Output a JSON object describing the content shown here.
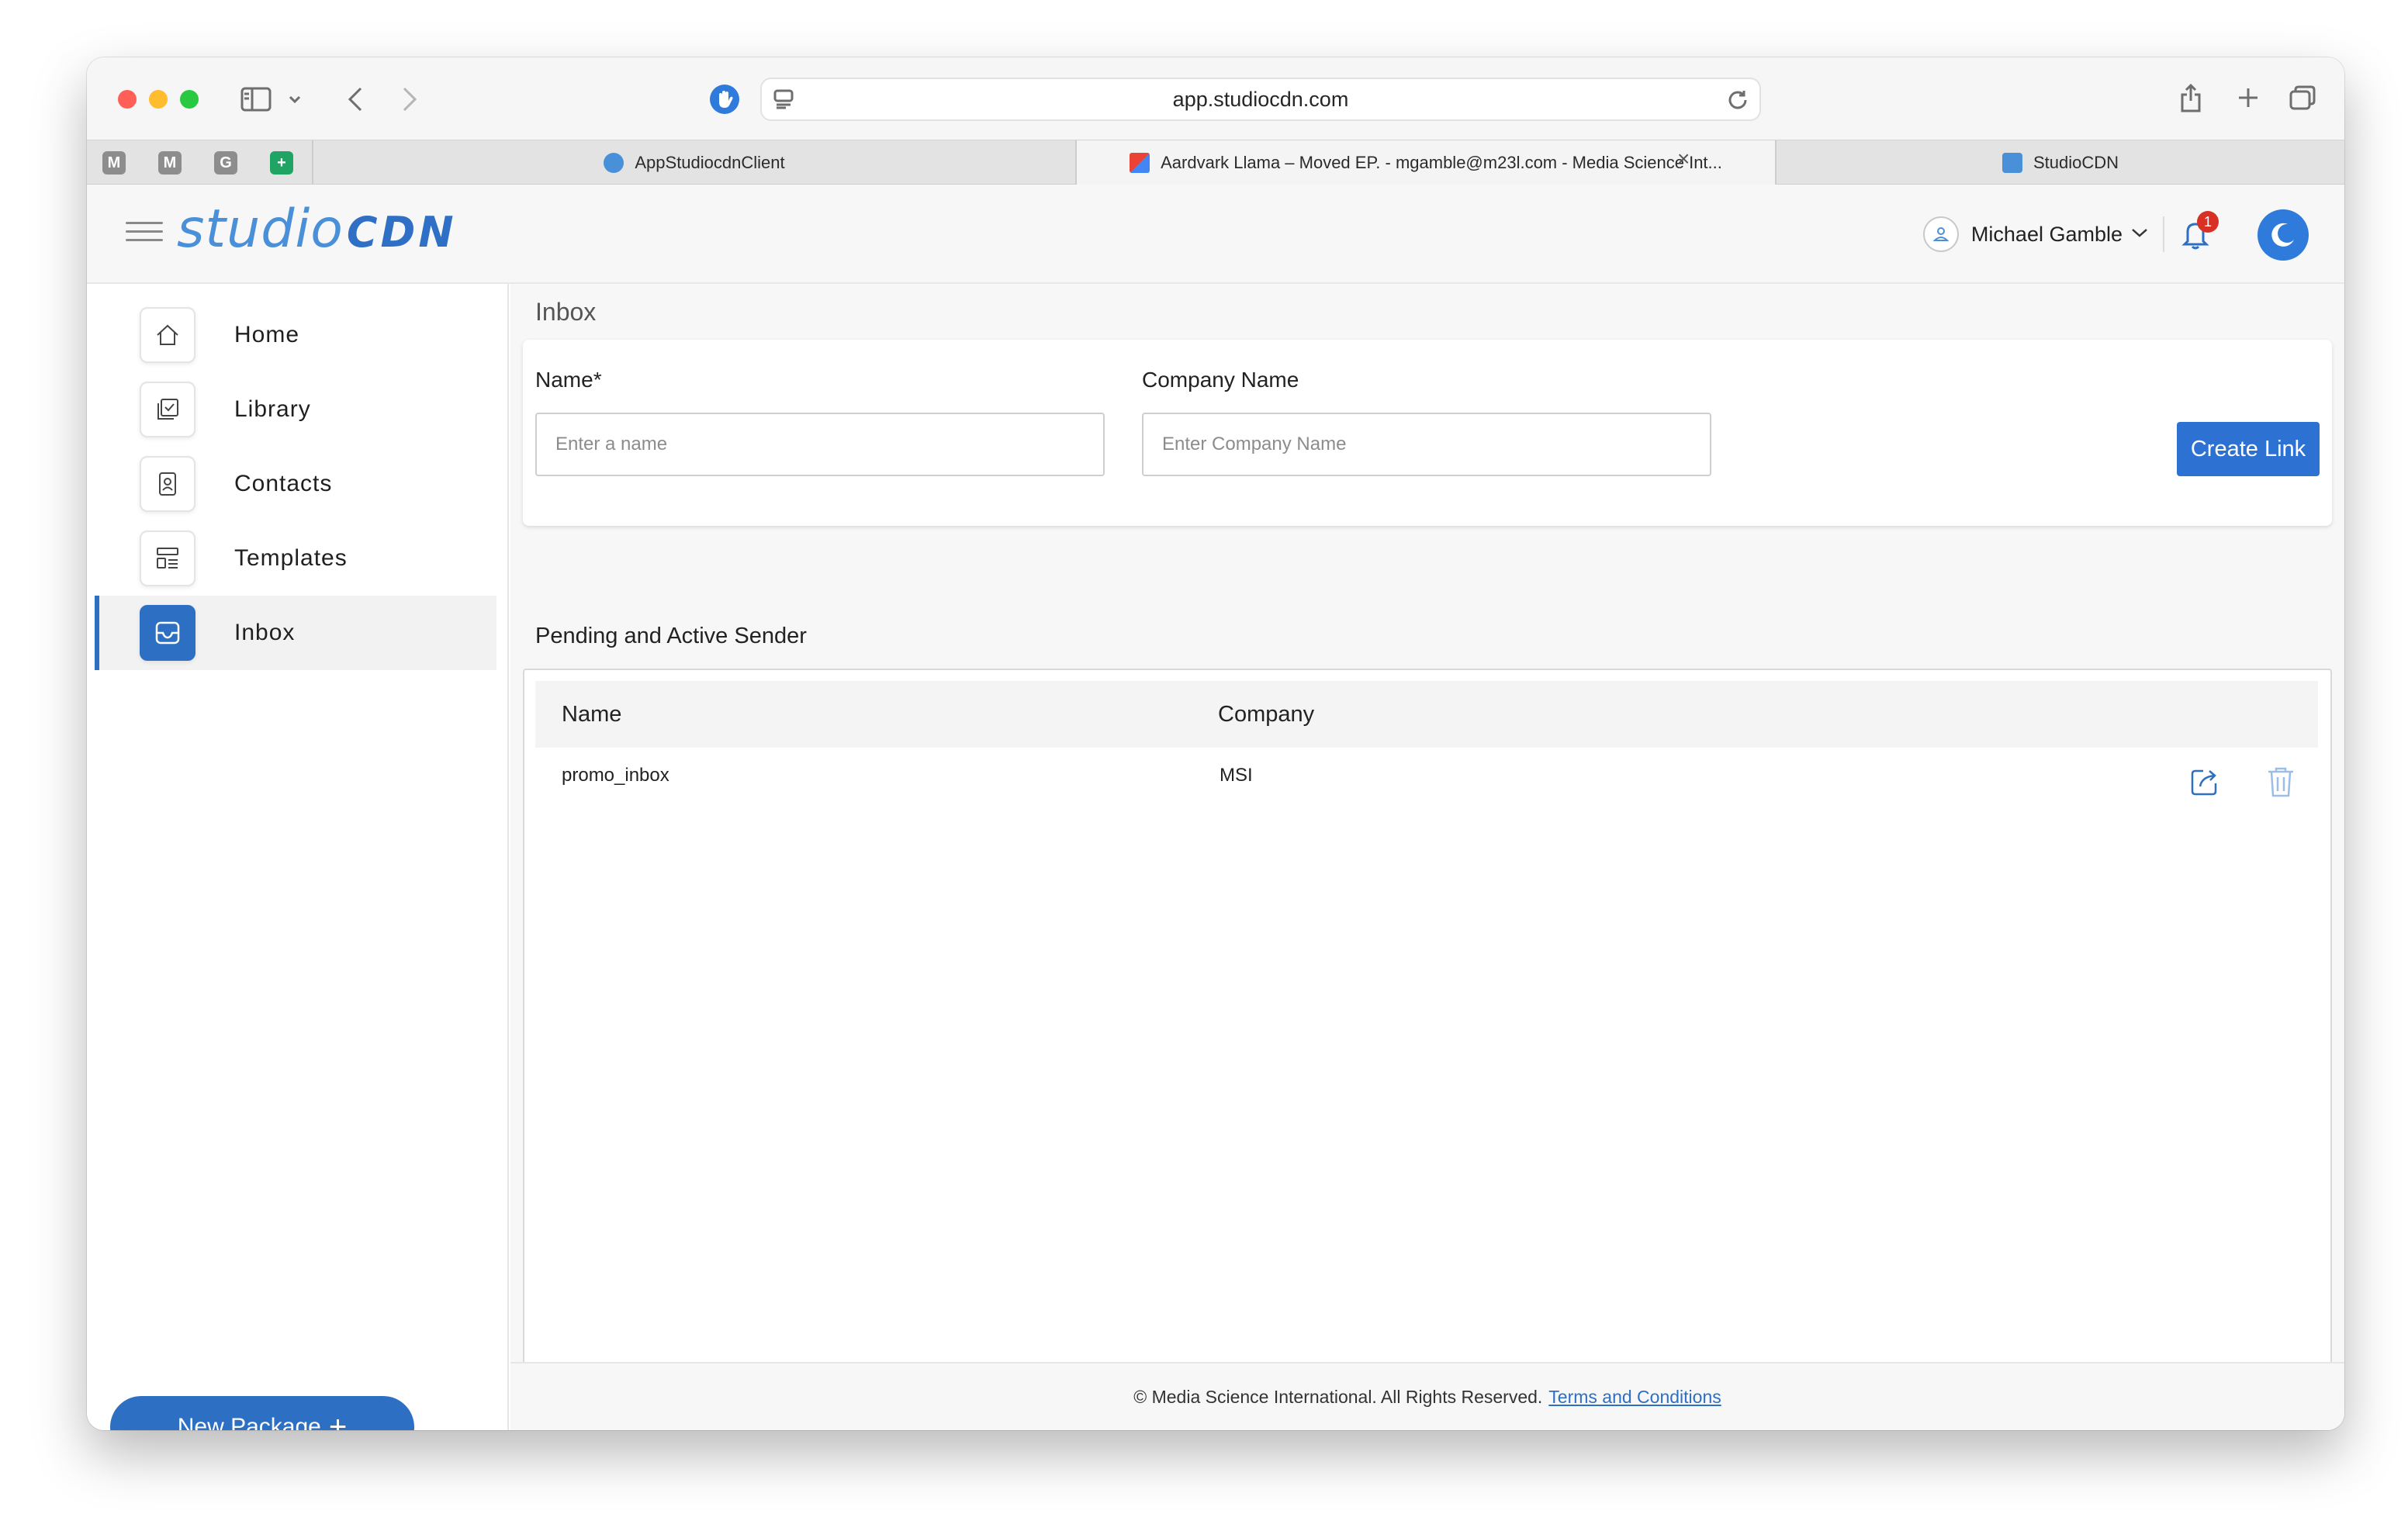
{
  "browser": {
    "url": "app.studiocdn.com",
    "pinned_tabs": [
      "M",
      "M",
      "G",
      "+"
    ],
    "tabs": [
      {
        "label": "AppStudiocdnClient"
      },
      {
        "label": "Aardvark Llama – Moved EP. - mgamble@m23l.com - Media Science Int..."
      },
      {
        "label": "StudioCDN"
      }
    ],
    "close_glyph": "×"
  },
  "header": {
    "logo_studio": "studio",
    "logo_cdn": "CDN",
    "user_name": "Michael Gamble",
    "notification_count": "1"
  },
  "sidebar": {
    "items": [
      {
        "label": "Home",
        "icon": "home-icon"
      },
      {
        "label": "Library",
        "icon": "library-icon"
      },
      {
        "label": "Contacts",
        "icon": "contacts-icon"
      },
      {
        "label": "Templates",
        "icon": "templates-icon"
      },
      {
        "label": "Inbox",
        "icon": "inbox-icon",
        "active": true
      }
    ],
    "new_package_label": "New Package",
    "new_package_plus": "+"
  },
  "main": {
    "title": "Inbox",
    "form": {
      "name_label": "Name*",
      "name_placeholder": "Enter a name",
      "name_value": "",
      "company_label": "Company Name",
      "company_placeholder": "Enter Company Name",
      "company_value": "",
      "create_label": "Create Link"
    },
    "section_title": "Pending and Active Sender",
    "table": {
      "columns": [
        "Name",
        "Company"
      ],
      "rows": [
        {
          "name": "promo_inbox",
          "company": "MSI"
        }
      ]
    }
  },
  "footer": {
    "text": "© Media Science International. All Rights Reserved.",
    "link": "Terms and Conditions"
  },
  "colors": {
    "accent": "#2d6fc3",
    "logo_light": "#4a90d9",
    "badge": "#d93025"
  }
}
